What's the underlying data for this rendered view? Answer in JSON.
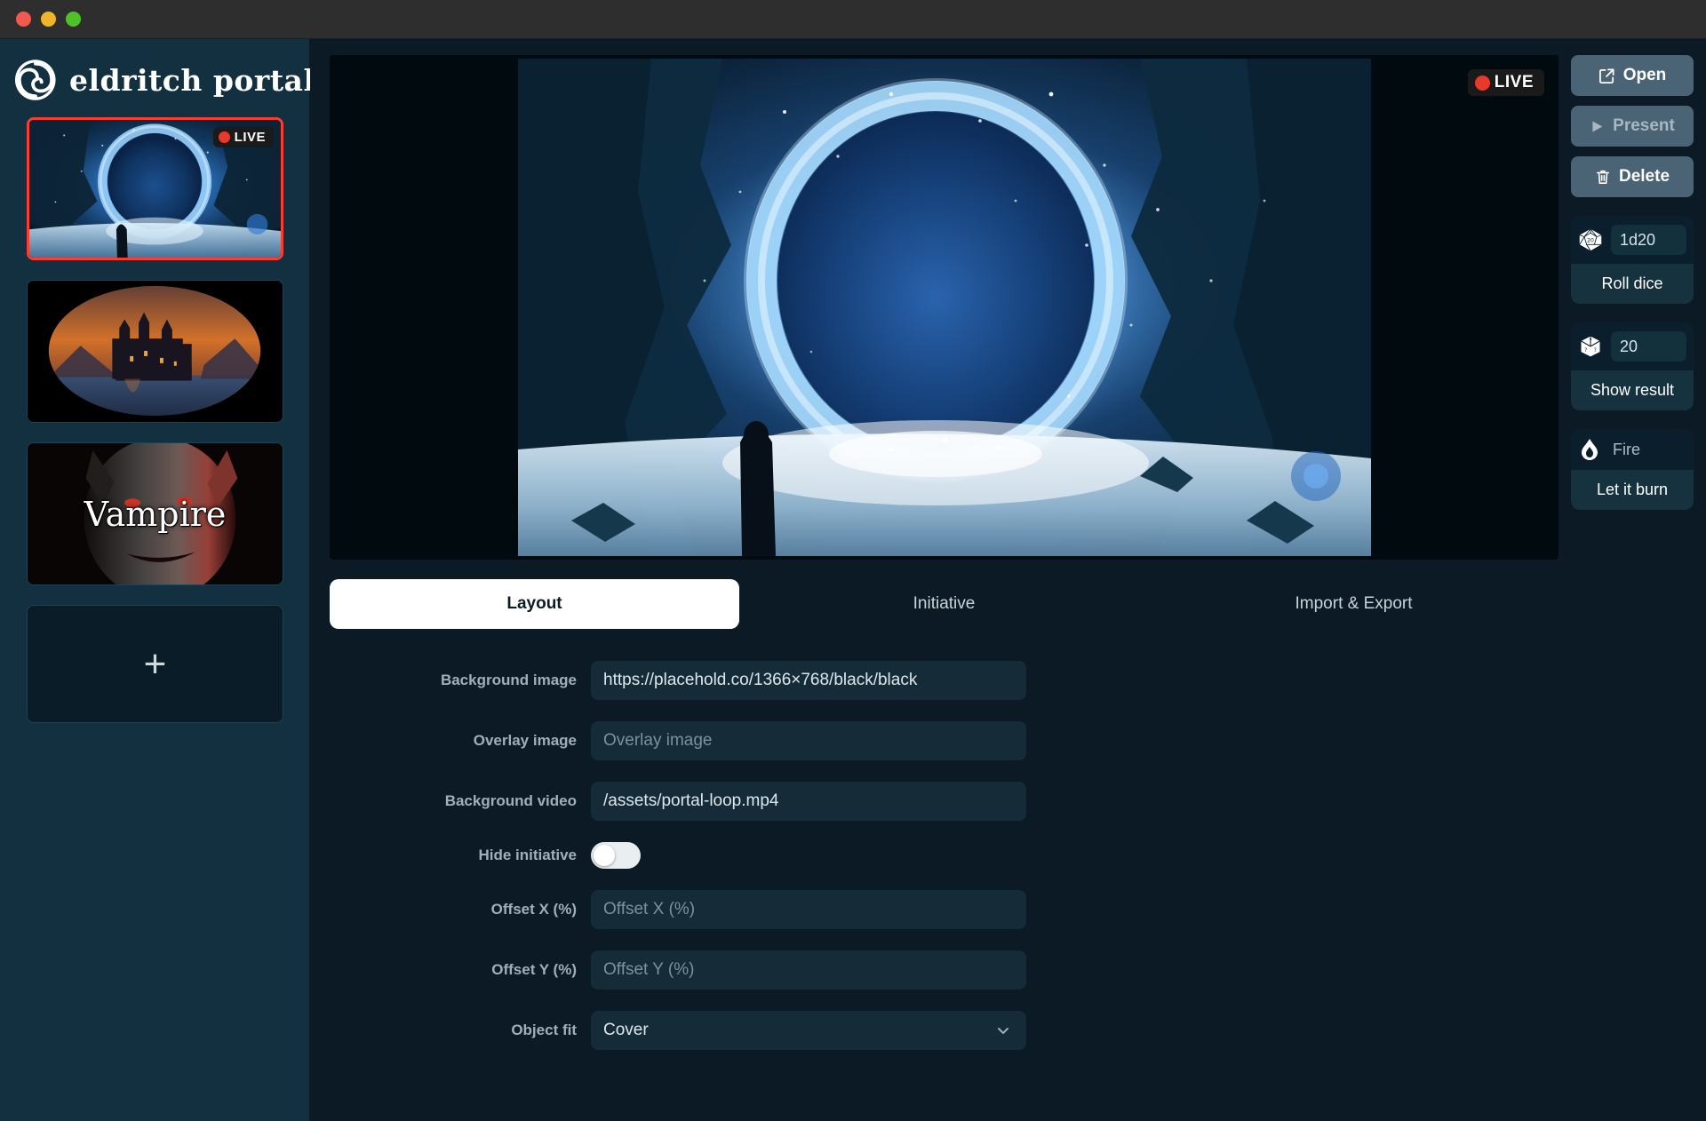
{
  "titlebar": {
    "traffic_lights": [
      "close",
      "minimize",
      "maximize"
    ]
  },
  "brand": {
    "name": "eldritch portal",
    "logo_icon": "spiral-vortex-icon"
  },
  "sidebar": {
    "scenes": [
      {
        "title": "",
        "live": true,
        "live_label": "LIVE",
        "art": "portal",
        "selected": true
      },
      {
        "title": "",
        "live": false,
        "art": "castle",
        "selected": false
      },
      {
        "title": "Vampire",
        "live": false,
        "art": "vampire",
        "selected": false
      }
    ],
    "add_scene_label": "+"
  },
  "preview": {
    "live_label": "LIVE",
    "art": "portal"
  },
  "rail": {
    "open_label": "Open",
    "open_icon": "external-link-icon",
    "present_label": "Present",
    "present_icon": "play-icon",
    "present_disabled": true,
    "delete_label": "Delete",
    "delete_icon": "trash-icon",
    "dice": {
      "icon": "d20-icon",
      "value": "1d20",
      "button_label": "Roll dice"
    },
    "result": {
      "icon": "mystery-die-icon",
      "value": "20",
      "button_label": "Show result"
    },
    "effect": {
      "icon": "flame-icon",
      "name": "Fire",
      "button_label": "Let it burn"
    }
  },
  "tabs": [
    {
      "label": "Layout",
      "active": true
    },
    {
      "label": "Initiative",
      "active": false
    },
    {
      "label": "Import & Export",
      "active": false
    }
  ],
  "form": {
    "background_image": {
      "label": "Background image",
      "value": "https://placehold.co/1366×768/black/black",
      "placeholder": "Background image"
    },
    "overlay_image": {
      "label": "Overlay image",
      "value": "",
      "placeholder": "Overlay image"
    },
    "background_video": {
      "label": "Background video",
      "value": "/assets/portal-loop.mp4",
      "placeholder": "Background video"
    },
    "hide_initiative": {
      "label": "Hide initiative",
      "checked": false
    },
    "offset_x": {
      "label": "Offset X (%)",
      "value": "",
      "placeholder": "Offset X (%)"
    },
    "offset_y": {
      "label": "Offset Y (%)",
      "value": "",
      "placeholder": "Offset Y (%)"
    },
    "object_fit": {
      "label": "Object fit",
      "value": "Cover",
      "chevron_icon": "chevron-down-icon"
    }
  },
  "colors": {
    "accent_live": "#e8392a",
    "selected_border": "#ff3b30",
    "sidebar_bg": "#12303f",
    "app_bg": "#0b1a24",
    "rail_button": "#4a6375"
  }
}
